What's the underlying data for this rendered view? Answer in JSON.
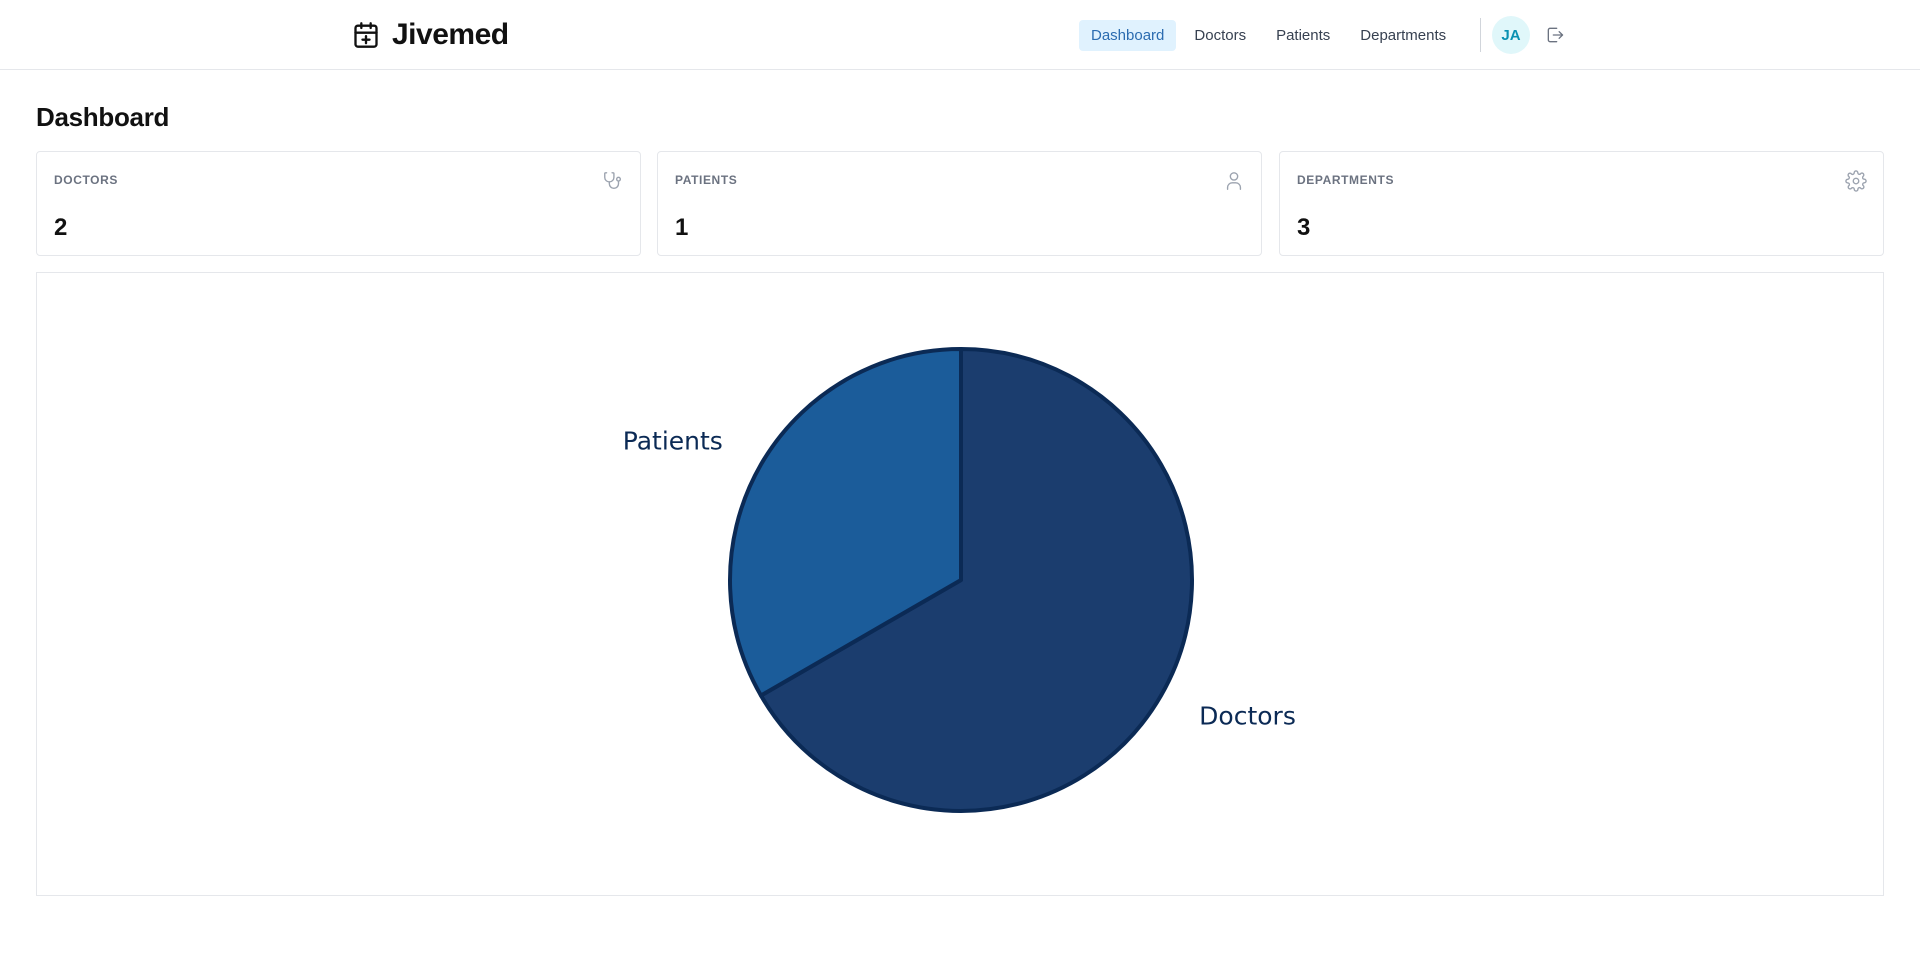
{
  "header": {
    "brand_name": "Jivemed",
    "brand_icon": "calendar-plus-icon",
    "nav": [
      {
        "label": "Dashboard",
        "active": true
      },
      {
        "label": "Doctors",
        "active": false
      },
      {
        "label": "Patients",
        "active": false
      },
      {
        "label": "Departments",
        "active": false
      }
    ],
    "avatar_initials": "JA",
    "logout_icon": "logout-icon",
    "active_nav_bg": "#e0f2fe",
    "active_nav_color": "#2b6cb0",
    "avatar_bg": "#e0f7fa",
    "avatar_color": "#0891b2"
  },
  "page": {
    "title": "Dashboard"
  },
  "stats": [
    {
      "label": "DOCTORS",
      "value": "2",
      "icon": "stethoscope-icon"
    },
    {
      "label": "PATIENTS",
      "value": "1",
      "icon": "user-icon"
    },
    {
      "label": "DEPARTMENTS",
      "value": "3",
      "icon": "gear-icon"
    }
  ],
  "chart_data": {
    "type": "pie",
    "title": "",
    "slices": [
      {
        "label": "Doctors",
        "value": 2,
        "color": "#1b3d6e"
      },
      {
        "label": "Patients",
        "value": 1,
        "color": "#1b5c9a"
      }
    ],
    "start_angle_deg": 0,
    "direction": "clockwise",
    "stroke_color": "#0b2a55",
    "label_color": "#0b2a55"
  }
}
